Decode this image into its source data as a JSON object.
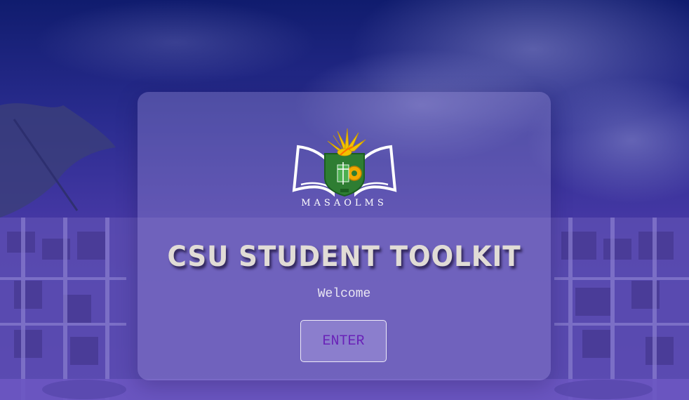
{
  "logo": {
    "text": "MASAOLMS",
    "icon": "masaolms-logo-icon"
  },
  "title": "CSU STUDENT TOOLKIT",
  "welcome": "Welcome",
  "enter_button": {
    "label": "ENTER"
  },
  "colors": {
    "sky_top": "#101c6e",
    "overlay_bottom": "#5b43b6",
    "title": "#e1dcd6",
    "button_text": "#6a22b8",
    "logo_green": "#2e7d32",
    "logo_gold": "#f2c200"
  }
}
